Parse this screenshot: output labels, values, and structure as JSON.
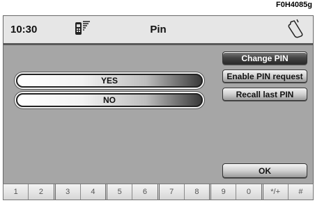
{
  "figure_code": "F0H4085g",
  "status_bar": {
    "time": "10:30",
    "title": "Pin",
    "left_icon": "phone-signal-icon",
    "right_icon": "mobile-phone-icon"
  },
  "answers": {
    "yes": "YES",
    "no": "NO"
  },
  "menu": {
    "change_pin": "Change PIN",
    "enable_pin": "Enable PIN request",
    "recall_pin": "Recall last PIN",
    "ok": "OK"
  },
  "keypad": [
    "1",
    "2",
    "3",
    "4",
    "5",
    "6",
    "7",
    "8",
    "9",
    "0",
    "*/+",
    "#"
  ]
}
